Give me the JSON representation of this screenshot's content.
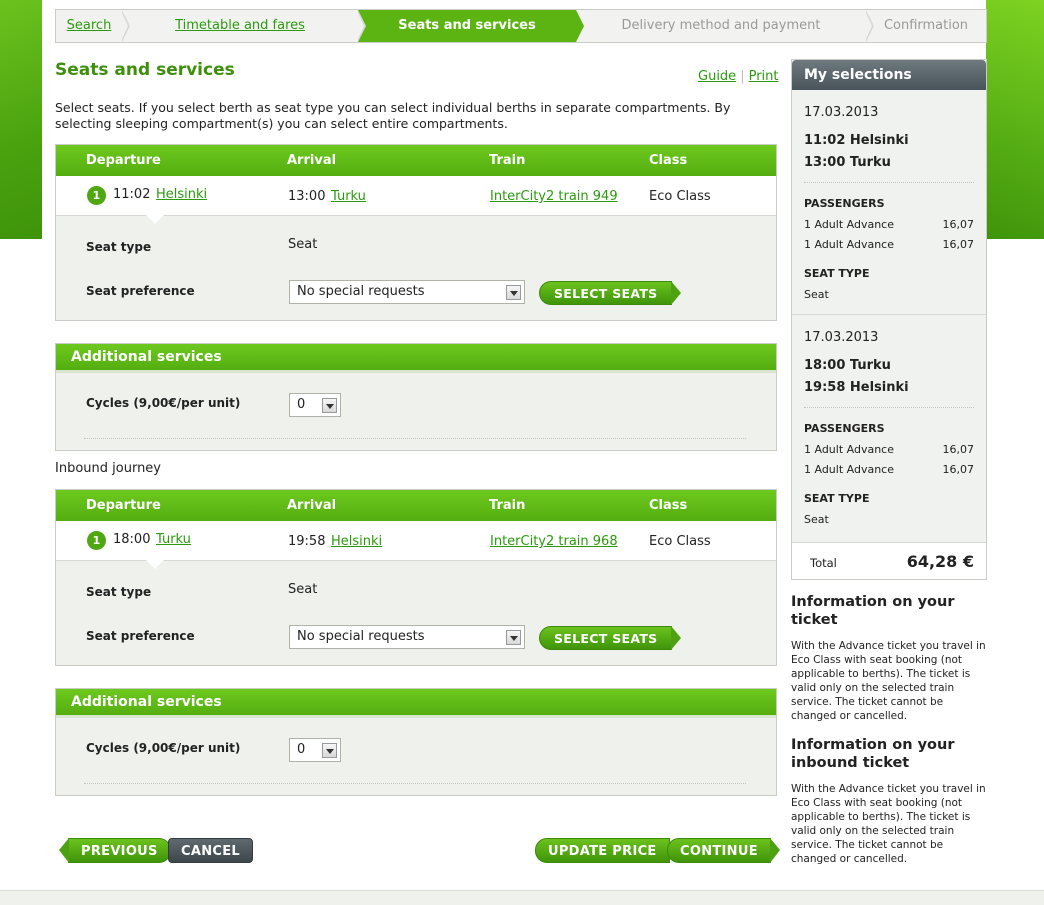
{
  "steps": [
    {
      "label": "Search",
      "state": "done"
    },
    {
      "label": "Timetable and fares",
      "state": "done"
    },
    {
      "label": "Seats and services",
      "state": "active"
    },
    {
      "label": "Delivery method and payment",
      "state": "upcoming"
    },
    {
      "label": "Confirmation",
      "state": "upcoming"
    }
  ],
  "title": "Seats and services",
  "links": {
    "guide": "Guide",
    "print": "Print"
  },
  "intro": "Select seats. If you select berth as seat type you can select individual berths in separate compartments. By selecting sleeping compartment(s) you can select entire compartments.",
  "table_headers": {
    "departure": "Departure",
    "arrival": "Arrival",
    "train": "Train",
    "class": "Class"
  },
  "outbound": {
    "num": "1",
    "dep_time": "11:02",
    "dep_station": "Helsinki",
    "arr_time": "13:00",
    "arr_station": "Turku",
    "train": "InterCity2 train 949",
    "class": "Eco Class",
    "seat_type_label": "Seat type",
    "seat_type": "Seat",
    "seat_pref_label": "Seat preference",
    "seat_pref": "No special requests",
    "select_seats": "SELECT SEATS"
  },
  "additional_out": {
    "title": "Additional services",
    "cycles_label": "Cycles (9,00€/per unit)",
    "cycles_value": "0"
  },
  "inbound_title": "Inbound journey",
  "inbound": {
    "num": "1",
    "dep_time": "18:00",
    "dep_station": "Turku",
    "arr_time": "19:58",
    "arr_station": "Helsinki",
    "train": "InterCity2 train 968",
    "class": "Eco Class",
    "seat_type_label": "Seat type",
    "seat_type": "Seat",
    "seat_pref_label": "Seat preference",
    "seat_pref": "No special requests",
    "select_seats": "SELECT SEATS"
  },
  "additional_in": {
    "title": "Additional services",
    "cycles_label": "Cycles (9,00€/per unit)",
    "cycles_value": "0"
  },
  "buttons": {
    "previous": "PREVIOUS",
    "cancel": "CANCEL",
    "update": "UPDATE PRICE",
    "continue": "CONTINUE"
  },
  "selections": {
    "title": "My selections",
    "trips": [
      {
        "date": "17.03.2013",
        "dep": "11:02 Helsinki",
        "arr": "13:00 Turku",
        "passengers_label": "PASSENGERS",
        "passengers": [
          {
            "name": "1 Adult Advance",
            "price": "16,07"
          },
          {
            "name": "1 Adult Advance",
            "price": "16,07"
          }
        ],
        "seat_type_label": "SEAT TYPE",
        "seat_type": "Seat"
      },
      {
        "date": "17.03.2013",
        "dep": "18:00 Turku",
        "arr": "19:58 Helsinki",
        "passengers_label": "PASSENGERS",
        "passengers": [
          {
            "name": "1 Adult Advance",
            "price": "16,07"
          },
          {
            "name": "1 Adult Advance",
            "price": "16,07"
          }
        ],
        "seat_type_label": "SEAT TYPE",
        "seat_type": "Seat"
      }
    ],
    "total_label": "Total",
    "total_value": "64,28 €"
  },
  "info": {
    "ticket_title": "Information on your ticket",
    "ticket_text": "With the Advance ticket you travel in Eco Class with seat booking (not applicable to berths). The ticket is valid only on the selected train service. The ticket cannot be changed or cancelled.",
    "inbound_title": "Information on your inbound ticket",
    "inbound_text": "With the Advance ticket you travel in Eco Class with seat booking (not applicable to berths). The ticket is valid only on the selected train service. The ticket cannot be changed or cancelled."
  }
}
